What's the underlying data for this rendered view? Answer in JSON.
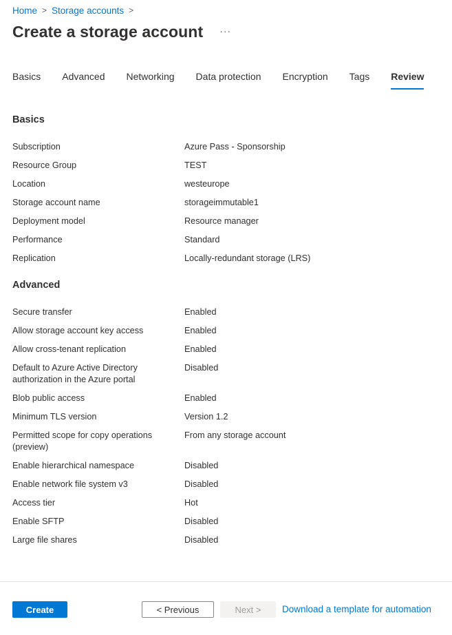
{
  "breadcrumb": {
    "items": [
      "Home",
      "Storage accounts"
    ],
    "separator": ">"
  },
  "header": {
    "title": "Create a storage account",
    "more_label": "···"
  },
  "tabs": [
    {
      "label": "Basics"
    },
    {
      "label": "Advanced"
    },
    {
      "label": "Networking"
    },
    {
      "label": "Data protection"
    },
    {
      "label": "Encryption"
    },
    {
      "label": "Tags"
    },
    {
      "label": "Review",
      "active": true
    }
  ],
  "sections": {
    "basics": {
      "title": "Basics",
      "rows": [
        {
          "label": "Subscription",
          "value": "Azure Pass - Sponsorship"
        },
        {
          "label": "Resource Group",
          "value": "TEST"
        },
        {
          "label": "Location",
          "value": "westeurope"
        },
        {
          "label": "Storage account name",
          "value": "storageimmutable1"
        },
        {
          "label": "Deployment model",
          "value": "Resource manager"
        },
        {
          "label": "Performance",
          "value": "Standard"
        },
        {
          "label": "Replication",
          "value": "Locally-redundant storage (LRS)"
        }
      ]
    },
    "advanced": {
      "title": "Advanced",
      "rows": [
        {
          "label": "Secure transfer",
          "value": "Enabled"
        },
        {
          "label": "Allow storage account key access",
          "value": "Enabled"
        },
        {
          "label": "Allow cross-tenant replication",
          "value": "Enabled"
        },
        {
          "label": "Default to Azure Active Directory authorization in the Azure portal",
          "value": "Disabled"
        },
        {
          "label": "Blob public access",
          "value": "Enabled"
        },
        {
          "label": "Minimum TLS version",
          "value": "Version 1.2"
        },
        {
          "label": "Permitted scope for copy operations (preview)",
          "value": "From any storage account"
        },
        {
          "label": "Enable hierarchical namespace",
          "value": "Disabled"
        },
        {
          "label": "Enable network file system v3",
          "value": "Disabled"
        },
        {
          "label": "Access tier",
          "value": "Hot"
        },
        {
          "label": "Enable SFTP",
          "value": "Disabled"
        },
        {
          "label": "Large file shares",
          "value": "Disabled"
        }
      ]
    }
  },
  "footer": {
    "create_label": "Create",
    "previous_label": "< Previous",
    "next_label": "Next >",
    "download_label": "Download a template for automation"
  },
  "colors": {
    "accent": "#0078d4",
    "text": "#323130",
    "disabled_bg": "#f3f2f1",
    "disabled_text": "#a19f9d"
  }
}
